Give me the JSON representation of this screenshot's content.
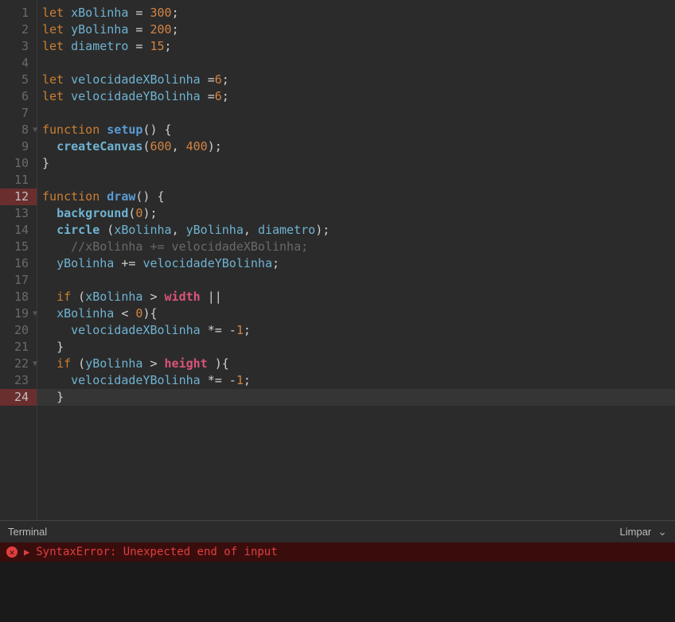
{
  "terminal": {
    "title": "Terminal",
    "clear": "Limpar"
  },
  "error": {
    "message": "SyntaxError: Unexpected end of input"
  },
  "code": {
    "lines": [
      {
        "n": 1,
        "tokens": [
          [
            "kw",
            "let "
          ],
          [
            "var",
            "xBolinha"
          ],
          [
            "op",
            " = "
          ],
          [
            "num",
            "300"
          ],
          [
            "op",
            ";"
          ]
        ]
      },
      {
        "n": 2,
        "tokens": [
          [
            "kw",
            "let "
          ],
          [
            "var",
            "yBolinha"
          ],
          [
            "op",
            " = "
          ],
          [
            "num",
            "200"
          ],
          [
            "op",
            ";"
          ]
        ]
      },
      {
        "n": 3,
        "tokens": [
          [
            "kw",
            "let "
          ],
          [
            "var",
            "diametro"
          ],
          [
            "op",
            " = "
          ],
          [
            "num",
            "15"
          ],
          [
            "op",
            ";"
          ]
        ]
      },
      {
        "n": 4,
        "tokens": []
      },
      {
        "n": 5,
        "tokens": [
          [
            "kw",
            "let "
          ],
          [
            "var",
            "velocidadeXBolinha"
          ],
          [
            "op",
            " ="
          ],
          [
            "num",
            "6"
          ],
          [
            "op",
            ";"
          ]
        ]
      },
      {
        "n": 6,
        "tokens": [
          [
            "kw",
            "let "
          ],
          [
            "var",
            "velocidadeYBolinha"
          ],
          [
            "op",
            " ="
          ],
          [
            "num",
            "6"
          ],
          [
            "op",
            ";"
          ]
        ]
      },
      {
        "n": 7,
        "tokens": []
      },
      {
        "n": 8,
        "fold": true,
        "tokens": [
          [
            "kw",
            "function "
          ],
          [
            "func",
            "setup"
          ],
          [
            "op",
            "() "
          ],
          [
            "brace",
            "{"
          ]
        ]
      },
      {
        "n": 9,
        "tokens": [
          [
            "op",
            "  "
          ],
          [
            "call",
            "createCanvas"
          ],
          [
            "op",
            "("
          ],
          [
            "num",
            "600"
          ],
          [
            "op",
            ", "
          ],
          [
            "num",
            "400"
          ],
          [
            "op",
            ");"
          ]
        ]
      },
      {
        "n": 10,
        "tokens": [
          [
            "brace",
            "}"
          ]
        ]
      },
      {
        "n": 11,
        "tokens": []
      },
      {
        "n": 12,
        "hl": true,
        "tokens": [
          [
            "kw",
            "function "
          ],
          [
            "func",
            "draw"
          ],
          [
            "op",
            "() "
          ],
          [
            "brace",
            "{"
          ]
        ]
      },
      {
        "n": 13,
        "tokens": [
          [
            "op",
            "  "
          ],
          [
            "call",
            "background"
          ],
          [
            "op",
            "("
          ],
          [
            "num",
            "0"
          ],
          [
            "op",
            ");"
          ]
        ]
      },
      {
        "n": 14,
        "tokens": [
          [
            "op",
            "  "
          ],
          [
            "call",
            "circle"
          ],
          [
            "op",
            " ("
          ],
          [
            "var",
            "xBolinha"
          ],
          [
            "op",
            ", "
          ],
          [
            "var",
            "yBolinha"
          ],
          [
            "op",
            ", "
          ],
          [
            "var",
            "diametro"
          ],
          [
            "op",
            ");"
          ]
        ]
      },
      {
        "n": 15,
        "tokens": [
          [
            "op",
            "    "
          ],
          [
            "cmt",
            "//xBolinha += velocidadeXBolinha;"
          ]
        ]
      },
      {
        "n": 16,
        "tokens": [
          [
            "op",
            "  "
          ],
          [
            "var",
            "yBolinha"
          ],
          [
            "op",
            " += "
          ],
          [
            "var",
            "velocidadeYBolinha"
          ],
          [
            "op",
            ";"
          ]
        ]
      },
      {
        "n": 17,
        "tokens": []
      },
      {
        "n": 18,
        "tokens": [
          [
            "op",
            "  "
          ],
          [
            "kw",
            "if"
          ],
          [
            "op",
            " ("
          ],
          [
            "var",
            "xBolinha"
          ],
          [
            "op",
            " > "
          ],
          [
            "const",
            "width"
          ],
          [
            "op",
            " ||"
          ]
        ]
      },
      {
        "n": 19,
        "fold": true,
        "tokens": [
          [
            "op",
            "  "
          ],
          [
            "var",
            "xBolinha"
          ],
          [
            "op",
            " < "
          ],
          [
            "num",
            "0"
          ],
          [
            "op",
            ")"
          ],
          [
            "brace",
            "{"
          ]
        ]
      },
      {
        "n": 20,
        "tokens": [
          [
            "op",
            "    "
          ],
          [
            "var",
            "velocidadeXBolinha"
          ],
          [
            "op",
            " *= -"
          ],
          [
            "num",
            "1"
          ],
          [
            "op",
            ";"
          ]
        ]
      },
      {
        "n": 21,
        "tokens": [
          [
            "op",
            "  "
          ],
          [
            "brace",
            "}"
          ]
        ]
      },
      {
        "n": 22,
        "fold": true,
        "tokens": [
          [
            "op",
            "  "
          ],
          [
            "kw",
            "if"
          ],
          [
            "op",
            " ("
          ],
          [
            "var",
            "yBolinha"
          ],
          [
            "op",
            " > "
          ],
          [
            "const",
            "height"
          ],
          [
            "op",
            " )"
          ],
          [
            "brace",
            "{"
          ]
        ]
      },
      {
        "n": 23,
        "tokens": [
          [
            "op",
            "    "
          ],
          [
            "var",
            "velocidadeYBolinha"
          ],
          [
            "op",
            " *= -"
          ],
          [
            "num",
            "1"
          ],
          [
            "op",
            ";"
          ]
        ]
      },
      {
        "n": 24,
        "hl": true,
        "active": true,
        "tokens": [
          [
            "op",
            "  "
          ],
          [
            "brace",
            "}"
          ]
        ]
      }
    ]
  }
}
